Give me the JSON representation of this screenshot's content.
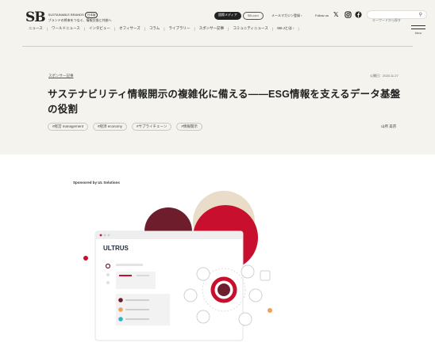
{
  "header": {
    "logo_mark": "SB",
    "logo_name": "SUSTAINABLE BRANDS",
    "logo_tag": "日本版",
    "logo_tagline": "ブランドの将来をつなぐ、情報交換と共創へ",
    "media_on": "国際メディア",
    "media_off": "SB.com",
    "newsletter": "メールマガジン登録 ›",
    "follow_label": "Follow us",
    "search_placeholder": "キーワードから探す"
  },
  "nav": {
    "items": [
      "ニュース",
      "ワールドニュース",
      "インタビュー",
      "オフィサーズ",
      "コラム",
      "ライブラリー",
      "スポンサー記事",
      "コミュニティニュース",
      "SB-Jとは ›"
    ],
    "menu_label": "Menu"
  },
  "article": {
    "category": "スポンサー記事",
    "date": "公開日：2023.11.27",
    "title": "サステナビリティ情報開示の複雑化に備える——ESG情報を支えるデータ基盤の役割",
    "tags": [
      "#経営 management",
      "#経済 economy",
      "#サプライチェーン",
      "#情報開示"
    ],
    "author": "山所 美宗"
  },
  "sponsor": {
    "label": "Sponsored by UL Solutions",
    "product": "ULTRUS"
  },
  "colors": {
    "background": "#f4f3ed",
    "brand_red": "#c8102e",
    "maroon": "#6e1d2c",
    "beige": "#e9dcc9"
  }
}
